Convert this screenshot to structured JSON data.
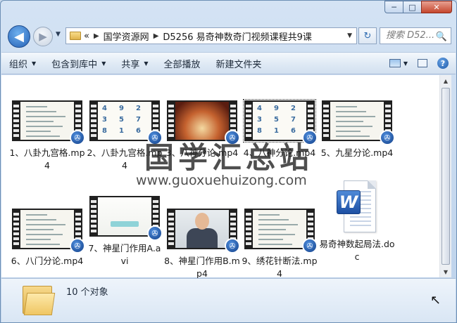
{
  "window": {
    "caption": {
      "minimize": "─",
      "maximize": "□",
      "close": "✕"
    }
  },
  "nav": {
    "back_glyph": "◀",
    "forward_glyph": "▶",
    "history_glyph": "▼",
    "address_prefix": "«",
    "breadcrumb": [
      "国学资源网",
      "D5256 易奇神数奇门视频课程共9课"
    ],
    "breadcrumb_sep": "▶",
    "address_drop": "▼",
    "refresh_glyph": "↻",
    "search_placeholder": "搜索 D52...",
    "search_glyph": "🔍"
  },
  "toolbar": {
    "items": [
      {
        "label": "组织",
        "dropdown": true
      },
      {
        "label": "包含到库中",
        "dropdown": true
      },
      {
        "label": "共享",
        "dropdown": true
      },
      {
        "label": "全部播放",
        "dropdown": false
      },
      {
        "label": "新建文件夹",
        "dropdown": false
      }
    ],
    "dropdown_glyph": "▼",
    "help_glyph": "?"
  },
  "files": [
    {
      "name": "1、八卦九宫格.mp4",
      "thumb": "doc"
    },
    {
      "name": "2、八卦九宫格.mp4",
      "thumb": "grid"
    },
    {
      "name": "3、八神分论.mp4",
      "thumb": "fire"
    },
    {
      "name": "4、八神分论.mp4",
      "thumb": "grid",
      "selected": true
    },
    {
      "name": "5、九星分论.mp4",
      "thumb": "doc"
    },
    {
      "name": "6、八门分论.mp4",
      "thumb": "doc"
    },
    {
      "name": "7、神星门作用A.avi",
      "thumb": "slide"
    },
    {
      "name": "8、神星门作用B.mp4",
      "thumb": "person"
    },
    {
      "name": "9、绣花针断法.mp4",
      "thumb": "doc"
    },
    {
      "name": "易奇神数起局法.doc",
      "thumb": "word"
    }
  ],
  "grid_digits": [
    "4",
    "9",
    "2",
    "3",
    "5",
    "7",
    "8",
    "1",
    "6"
  ],
  "word_badge": "W",
  "reel_glyph": "✇",
  "watermark": {
    "cn": "国学汇总站",
    "url": "www.guoxuehuizong.com"
  },
  "details": {
    "status": "10 个对象"
  },
  "scroll": {
    "up": "▲",
    "down": "▼"
  }
}
